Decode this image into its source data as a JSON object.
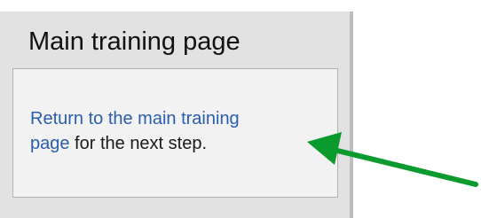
{
  "panel": {
    "title": "Main training page",
    "link_text_1": "Return to the main training",
    "link_text_2": "page",
    "suffix_text": " for the next step."
  },
  "colors": {
    "arrow": "#0a9a2e",
    "link": "#2a5db0"
  }
}
